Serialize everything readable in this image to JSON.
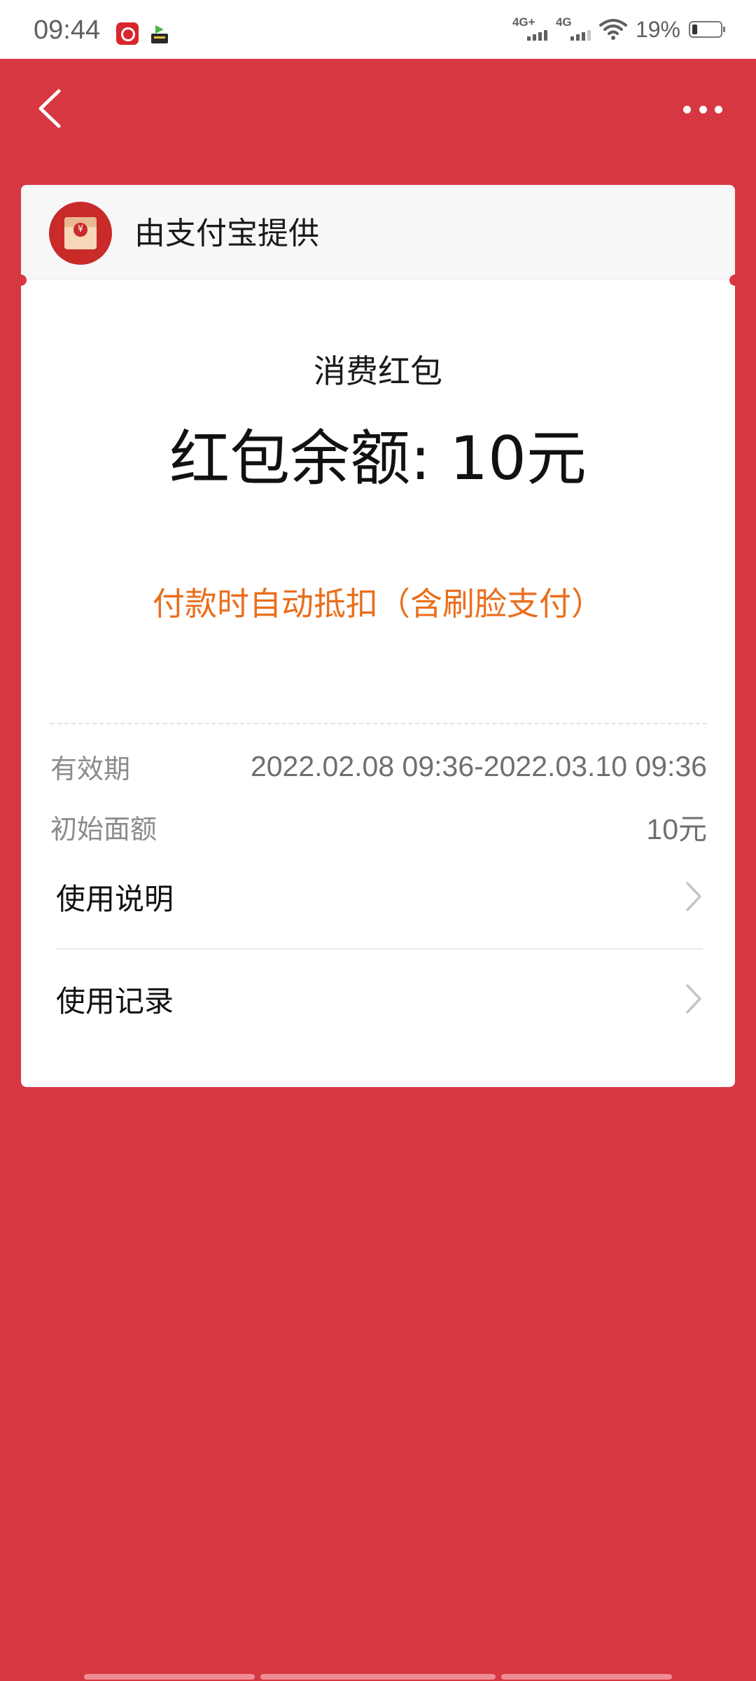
{
  "status_bar": {
    "time": "09:44",
    "network_1": "4G+",
    "network_2": "4G",
    "battery_percent": "19%",
    "battery_level": 0.19
  },
  "header": {
    "back_icon": "chevron-left-icon",
    "more_icon": "more-horizontal-icon"
  },
  "card": {
    "provider": {
      "icon": "red-envelope-icon",
      "label": "由支付宝提供"
    },
    "type": "消费红包",
    "balance": "红包余额: 10元",
    "auto_note": "付款时自动抵扣（含刷脸支付）",
    "validity": {
      "label": "有效期",
      "value": "2022.02.08 09:36-2022.03.10 09:36"
    },
    "initial_amount": {
      "label": "初始面额",
      "value": "10元"
    },
    "links": [
      {
        "label": "使用说明"
      },
      {
        "label": "使用记录"
      }
    ]
  },
  "colors": {
    "background": "#d73741",
    "accent_orange": "#ea6e1c",
    "avatar_red": "#c92a2a"
  }
}
